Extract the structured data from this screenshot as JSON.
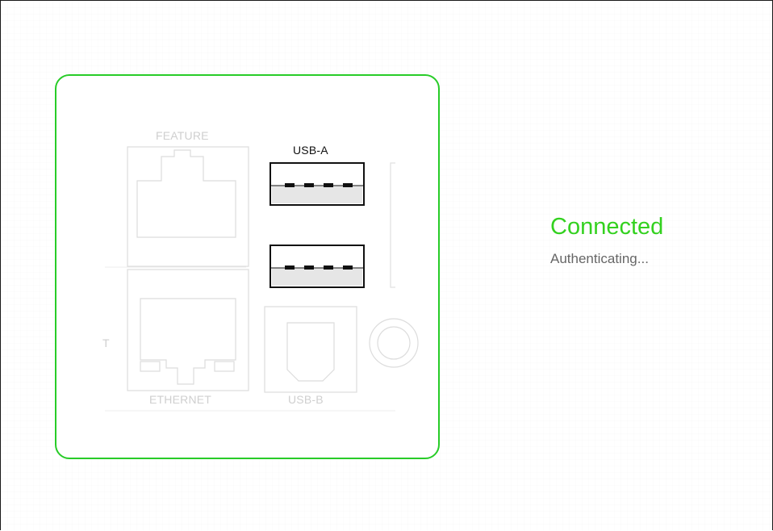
{
  "status": {
    "title": "Connected",
    "subtitle": "Authenticating..."
  },
  "ports": {
    "feature": "FEATURE",
    "usb_a": "USB-A",
    "ethernet": "ETHERNET",
    "usb_b": "USB-B",
    "edge_letter": "T"
  },
  "colors": {
    "accent": "#28cc28",
    "status_text": "#33d11f",
    "subtitle_text": "#666666",
    "muted_port": "#d6d6d6",
    "active_port": "#111111"
  },
  "icons": {
    "usb_a_port_top": "usb-a-port-icon",
    "usb_a_port_bottom": "usb-a-port-icon",
    "ethernet_port": "ethernet-port-icon",
    "feature_port": "feature-port-icon",
    "usb_b_port": "usb-b-port-icon",
    "power_jack": "power-jack-icon"
  }
}
